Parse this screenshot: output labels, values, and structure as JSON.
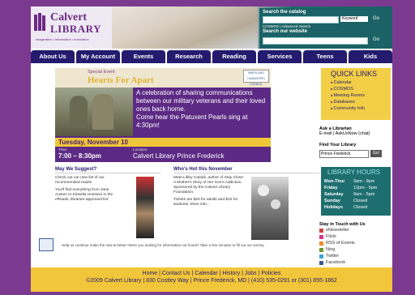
{
  "header": {
    "logo_line1": "Calvert",
    "logo_line2": "LIBRARY",
    "tagline": "imagination • information • innovation",
    "search_catalog_label": "Search the catalog",
    "search_scope": "Keyword",
    "go_label": "Go",
    "catalog_links": "COSMOS | Advanced Search",
    "search_website_label": "Search our website"
  },
  "nav": [
    "About Us",
    "My Account",
    "Events",
    "Research",
    "Reading",
    "Services",
    "Teens",
    "Kids"
  ],
  "banner": {
    "special_event": "Special Event",
    "title": "Hearts For Apart",
    "badge": "MARYLAND HUMANITIES COUNCIL",
    "description": "A celebration of sharing communications between our military veterans and their loved ones back home.",
    "description2": "Come hear the Patuxent Pearls sing at 4:30pm!",
    "date": "Tuesday, November 10",
    "time_label": "Time:",
    "time_value": "7:00 – 8:30pm",
    "location_label": "Location:",
    "location_value": "Calvert Library Prince Frederick"
  },
  "quick_links": {
    "title": "QUICK LINKS",
    "items": [
      "Calendar",
      "COSMOS",
      "Meeting Rooms",
      "Databases",
      "Community Info"
    ]
  },
  "ask": {
    "title": "Ask a Librarian",
    "links": "E-mail | AskUsNow (chat)"
  },
  "find": {
    "title": "Find Your Library",
    "selected": "Prince Frederick",
    "go": "Go!"
  },
  "hours": {
    "title": "LIBRARY HOURS",
    "rows": [
      {
        "day": "Mon-Thur",
        "time": "9am - 9pm"
      },
      {
        "day": "Friday",
        "time": "12pm - 5pm"
      },
      {
        "day": "Saturday",
        "time": "9am - 5pm"
      },
      {
        "day": "Sunday",
        "time": "Closed"
      },
      {
        "day": "Holidays",
        "time": "Closed"
      }
    ]
  },
  "stay": {
    "title": "Stay in Touch with Us",
    "items": [
      "eNewsletter",
      "Flickr",
      "RSS of Events",
      "Ning",
      "Twitter",
      "Facebook"
    ]
  },
  "suggest": {
    "title": "May We Suggest?",
    "p1": "Check out our new list of our recommended reads!",
    "p2": "You'll find everything from Jane Austen to Kinsella Hosseini in the eReads, librarian-approved list."
  },
  "month": {
    "title": "Who's Hot this November",
    "p1": "Meet Libby Cataldi, author of Stay Close: A Mother's Story of Her Son's Addiction. Sponsored by the Calvert Library Foundation.",
    "p2": "Tickets are $20 for adults and $10 for students. More info..."
  },
  "feedback": "Help us continue make the new & better! Were you looking for information not found? Take a few minutes to fill out our survey.",
  "footer": {
    "links": "Home | Contact Us | Calendar | History | Jobs | Policies",
    "copyright": "©2009 Calvert Library | 830 Costley Way | Prince Frederick, MD | (410) 535-0291 or (301) 855-1862"
  },
  "colors": {
    "purple": "#7b3a8f",
    "navy": "#241b6e",
    "gold": "#f2c63a",
    "teal": "#1e6e70"
  }
}
